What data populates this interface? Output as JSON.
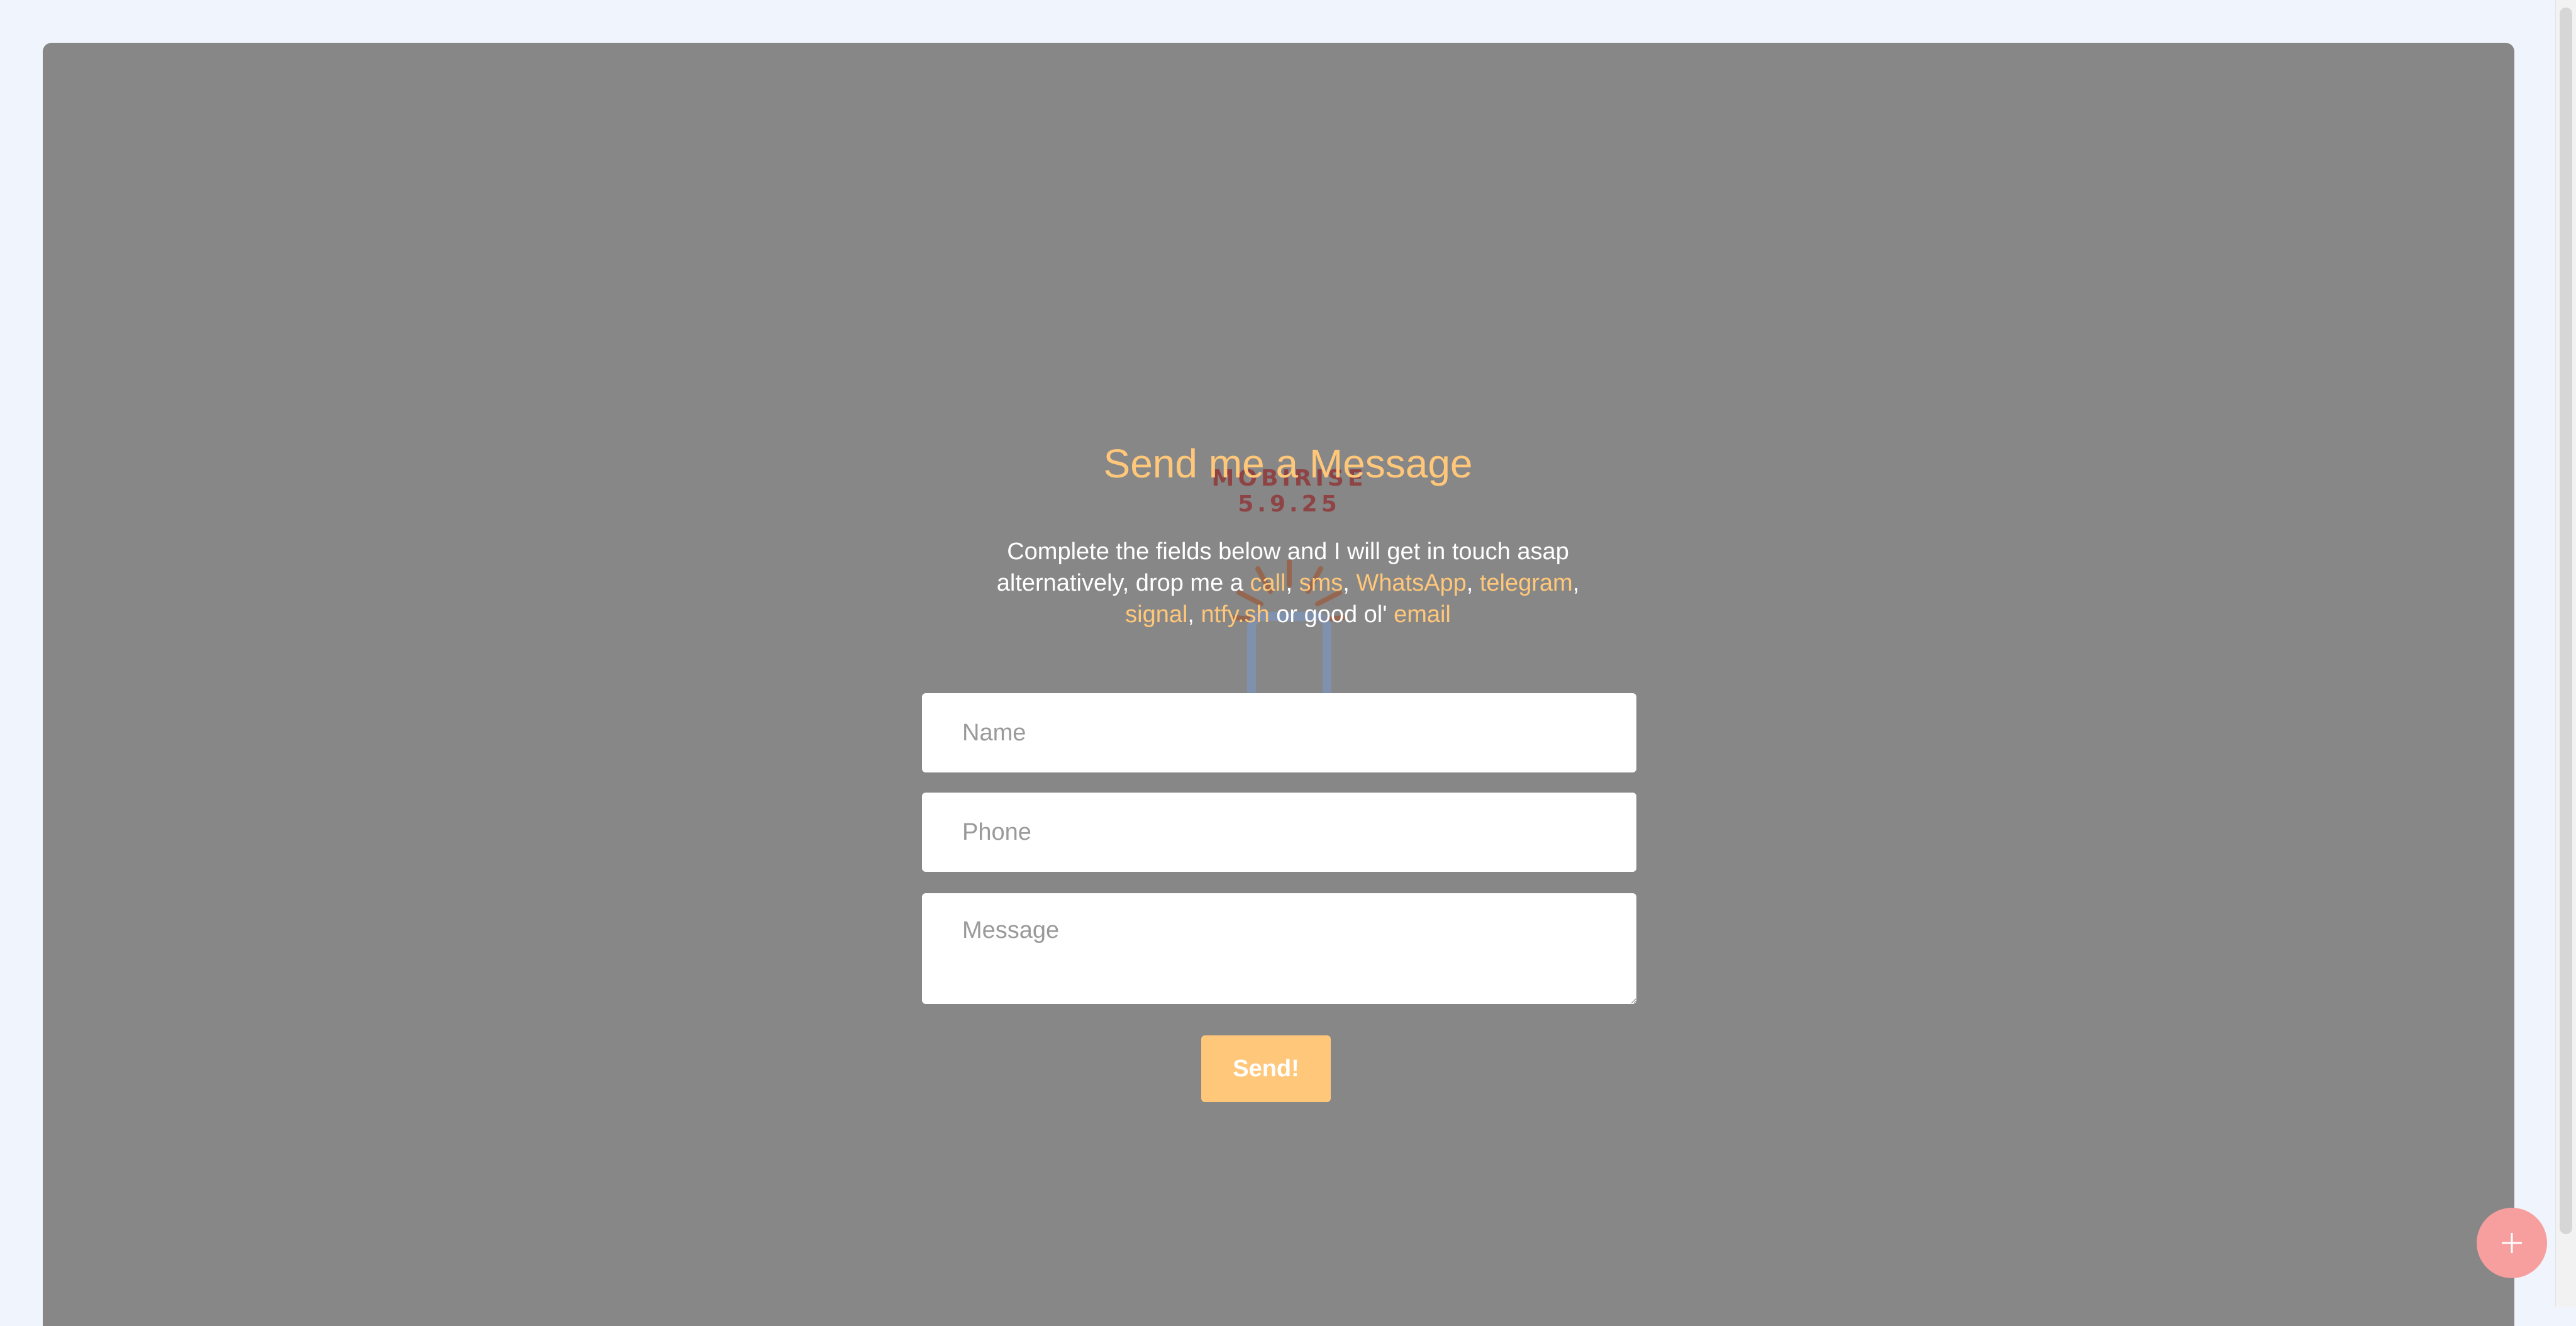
{
  "watermark": {
    "text": "MOBIRISE  5.9.25",
    "icon": "phone-icon"
  },
  "contact": {
    "title": "Send me a Message",
    "desc_line1": "Complete the fields below and I will get in touch asap",
    "desc_line2_prefix": "alternatively, drop me a ",
    "links": {
      "call": "call",
      "sms": "sms",
      "whatsapp": "WhatsApp",
      "telegram": "telegram",
      "signal": "signal",
      "ntfy": "ntfy.sh",
      "email": "email"
    },
    "sep": ", ",
    "trailing_comma": ",",
    "good_ol": " or good ol' ",
    "form": {
      "name_placeholder": "Name",
      "phone_placeholder": "Phone",
      "message_placeholder": "Message",
      "send_label": "Send!"
    }
  },
  "fab": {
    "icon": "plus-icon"
  },
  "colors": {
    "page_bg": "#f0f4fc",
    "panel_bg": "#878787",
    "accent": "#ffc77a",
    "fab": "#f79e9e"
  }
}
